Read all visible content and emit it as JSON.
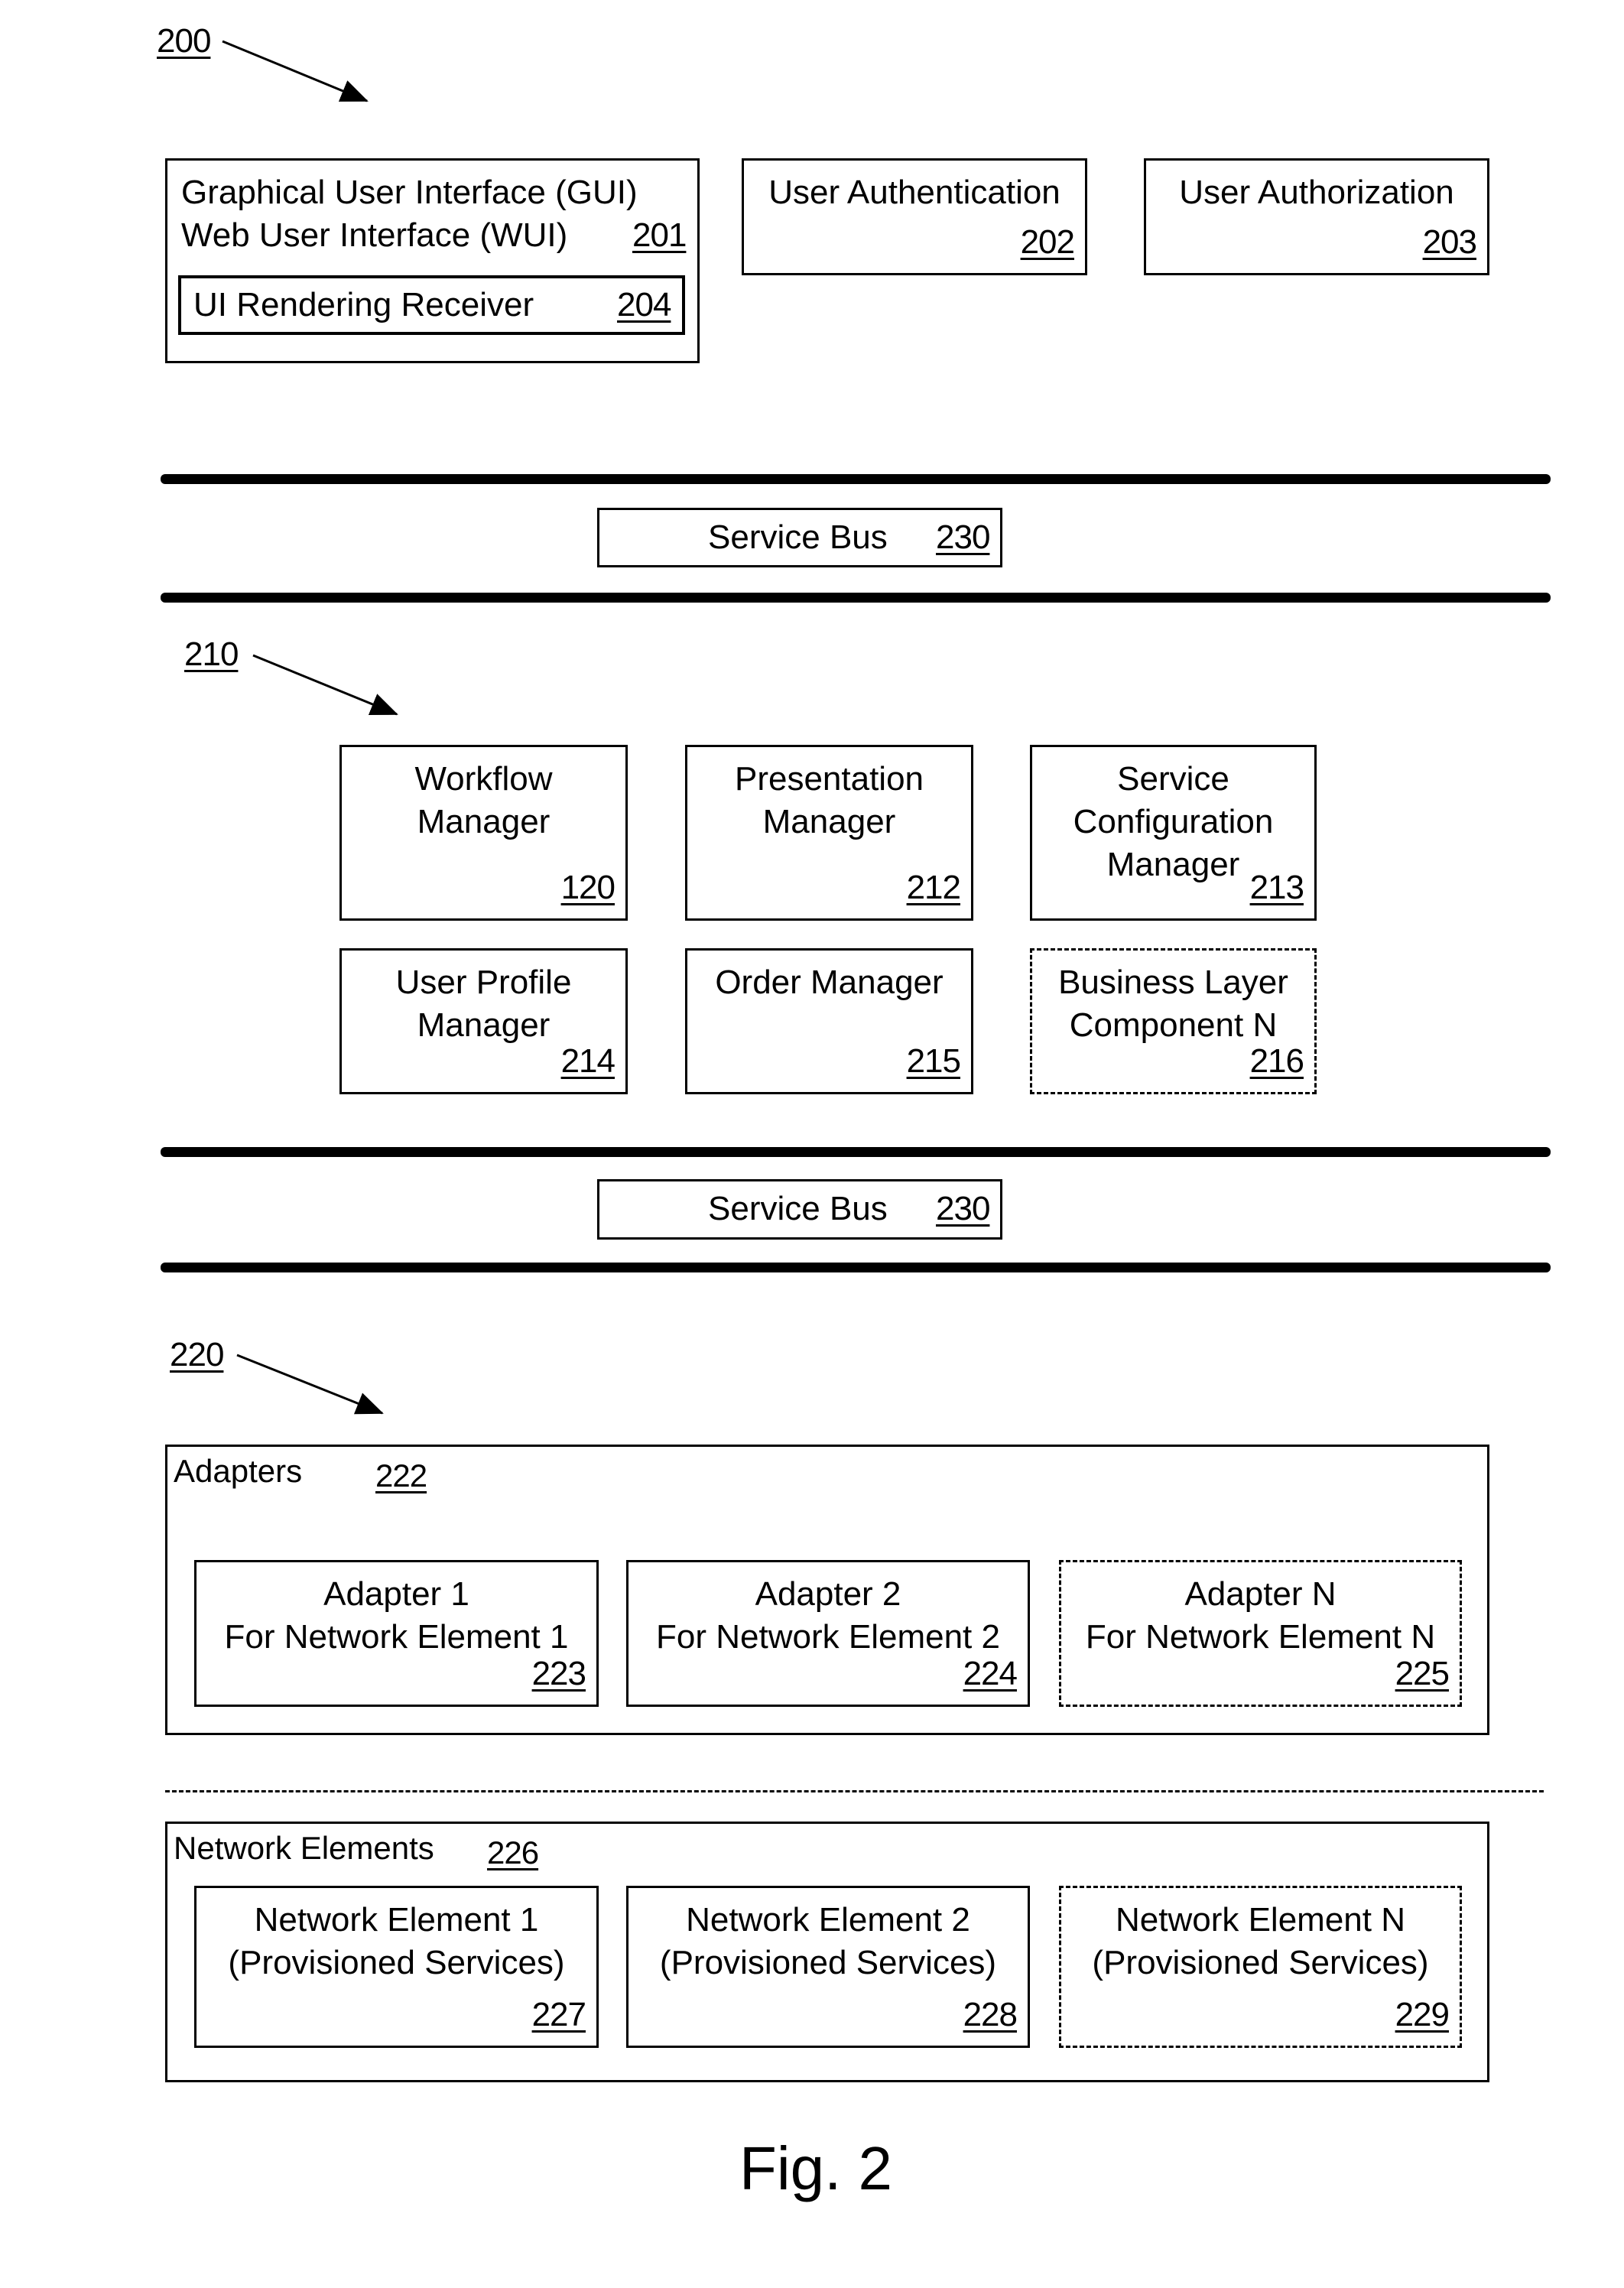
{
  "figure": {
    "caption": "Fig. 2",
    "ref": "200"
  },
  "presentation_layer": {
    "gui": {
      "line1": "Graphical User Interface (GUI)",
      "line2": "Web User Interface (WUI)",
      "ref": "201",
      "renderer": {
        "label": "UI Rendering Receiver",
        "ref": "204"
      }
    },
    "authentication": {
      "label": "User Authentication",
      "ref": "202"
    },
    "authorization": {
      "label": "User Authorization",
      "ref": "203"
    }
  },
  "service_bus_top": {
    "label": "Service Bus",
    "ref": "230"
  },
  "business_layer": {
    "ref": "210",
    "components": [
      {
        "lines": [
          "Workflow",
          "Manager"
        ],
        "ref": "120",
        "dashed": false
      },
      {
        "lines": [
          "Presentation",
          "Manager"
        ],
        "ref": "212",
        "dashed": false
      },
      {
        "lines": [
          "Service",
          "Configuration",
          "Manager"
        ],
        "ref": "213",
        "dashed": false
      },
      {
        "lines": [
          "User Profile",
          "Manager"
        ],
        "ref": "214",
        "dashed": false
      },
      {
        "lines": [
          "Order Manager"
        ],
        "ref": "215",
        "dashed": false
      },
      {
        "lines": [
          "Business Layer",
          "Component N"
        ],
        "ref": "216",
        "dashed": true
      }
    ]
  },
  "service_bus_bottom": {
    "label": "Service Bus",
    "ref": "230"
  },
  "integration_layer": {
    "ref": "220",
    "adapters": {
      "label": "Adapters",
      "ref": "222",
      "items": [
        {
          "line1": "Adapter 1",
          "line2": "For Network Element 1",
          "ref": "223",
          "dashed": false
        },
        {
          "line1": "Adapter 2",
          "line2": "For Network Element 2",
          "ref": "224",
          "dashed": false
        },
        {
          "line1": "Adapter N",
          "line2": "For Network Element N",
          "ref": "225",
          "dashed": true
        }
      ]
    },
    "network_elements": {
      "label": "Network Elements",
      "ref": "226",
      "items": [
        {
          "line1": "Network Element 1",
          "line2": "(Provisioned Services)",
          "ref": "227",
          "dashed": false
        },
        {
          "line1": "Network Element 2",
          "line2": "(Provisioned Services)",
          "ref": "228",
          "dashed": false
        },
        {
          "line1": "Network Element N",
          "line2": "(Provisioned Services)",
          "ref": "229",
          "dashed": true
        }
      ]
    }
  }
}
